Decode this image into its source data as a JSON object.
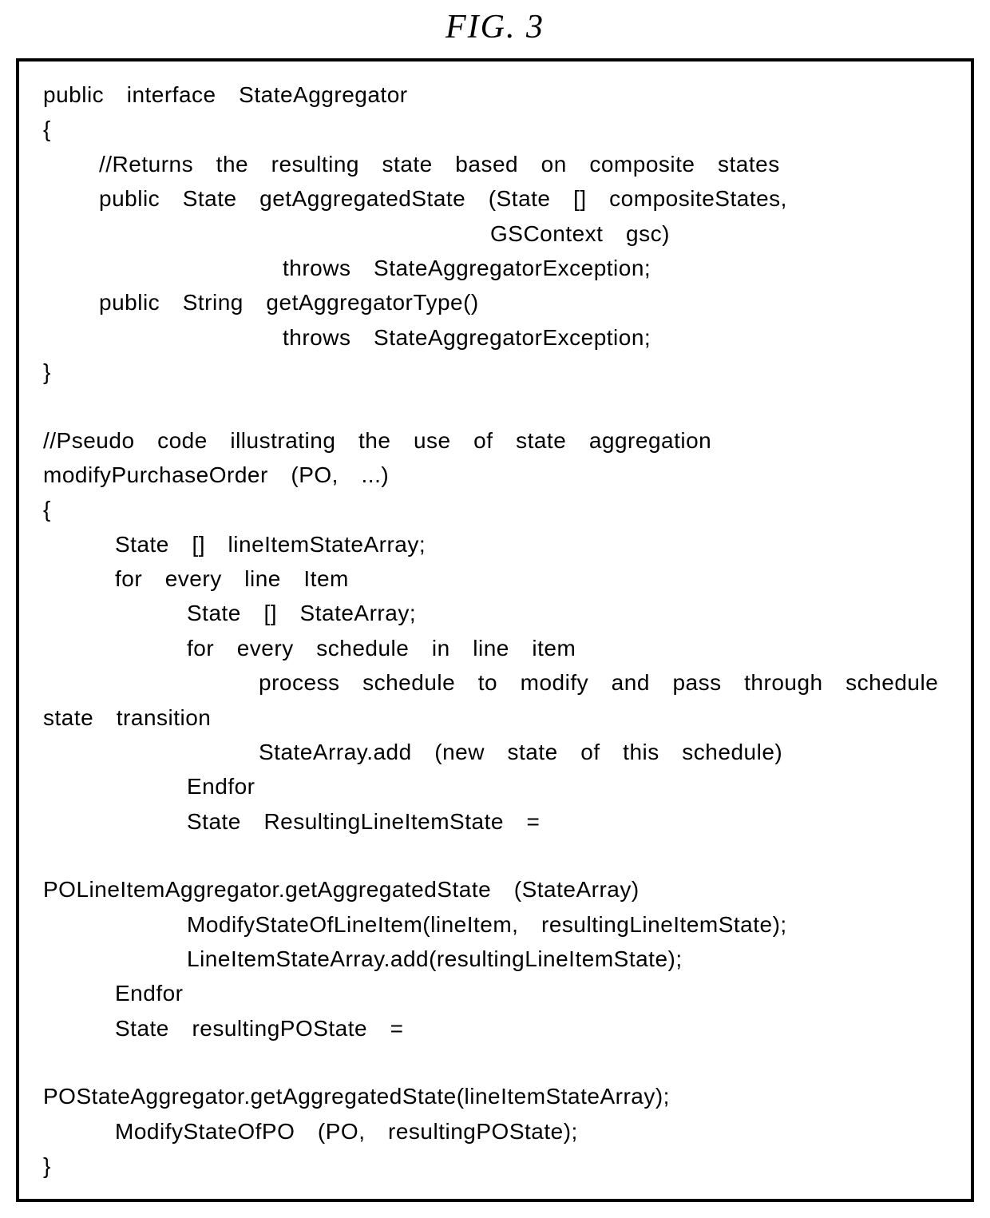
{
  "figure_title": "FIG.  3",
  "lines": {
    "l1": "public  interface  StateAggregator",
    "l2": "{",
    "l3": "//Returns  the  resulting  state  based  on  composite  states",
    "l4": "public  State  getAggregatedState  (State  []  compositeStates,",
    "l5": "GSContext  gsc)",
    "l6": "throws  StateAggregatorException;",
    "l7": "public  String  getAggregatorType()",
    "l8": "throws  StateAggregatorException;",
    "l9": "}",
    "l10": "//Pseudo  code  illustrating  the  use  of  state  aggregation",
    "l11": "modifyPurchaseOrder  (PO,  ...)",
    "l12": "{",
    "l13": "State  []  lineItemStateArray;",
    "l14": "for  every  line  Item",
    "l15": "State  []  StateArray;",
    "l16": "for  every  schedule  in  line  item",
    "l17": "process  schedule  to  modify  and  pass  through  schedule",
    "l18": "state  transition",
    "l19": "StateArray.add  (new  state  of  this  schedule)",
    "l20": "Endfor",
    "l21": "State  ResultingLineItemState  =",
    "l22": "POLineItemAggregator.getAggregatedState  (StateArray)",
    "l23": "ModifyStateOfLineItem(lineItem,  resultingLineItemState);",
    "l24": "LineItemStateArray.add(resultingLineItemState);",
    "l25": "Endfor",
    "l26": "State  resultingPOState  =",
    "l27": "POStateAggregator.getAggregatedState(lineItemStateArray);",
    "l28": "ModifyStateOfPO  (PO,  resultingPOState);",
    "l29": "}"
  }
}
